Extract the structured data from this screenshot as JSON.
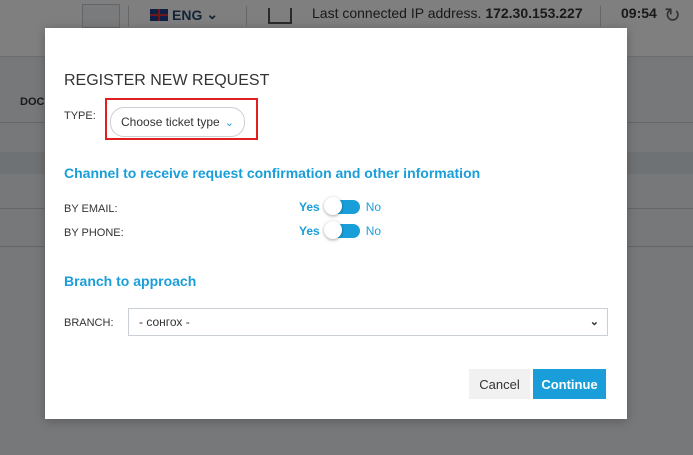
{
  "background": {
    "language": "ENG",
    "ip_label": "Last connected IP address.",
    "ip_value": "172.30.153.227",
    "time": "09:54",
    "doc_tab": "DOC"
  },
  "modal": {
    "title": "REGISTER NEW REQUEST",
    "type_label": "TYPE:",
    "type_select": "Choose ticket type",
    "channel_heading": "Channel to receive request confirmation and other information",
    "email_label": "BY EMAIL:",
    "phone_label": "BY PHONE:",
    "yes_label": "Yes",
    "no_label": "No",
    "branch_heading": "Branch to approach",
    "branch_label": "BRANCH:",
    "branch_value": "- сонгох -",
    "cancel_label": "Cancel",
    "continue_label": "Continue"
  },
  "colors": {
    "accent": "#1a9ed9",
    "highlight": "#e02020"
  },
  "icons": [
    "flag-icon",
    "monitor-icon",
    "refresh-icon",
    "chevron-down-icon"
  ]
}
